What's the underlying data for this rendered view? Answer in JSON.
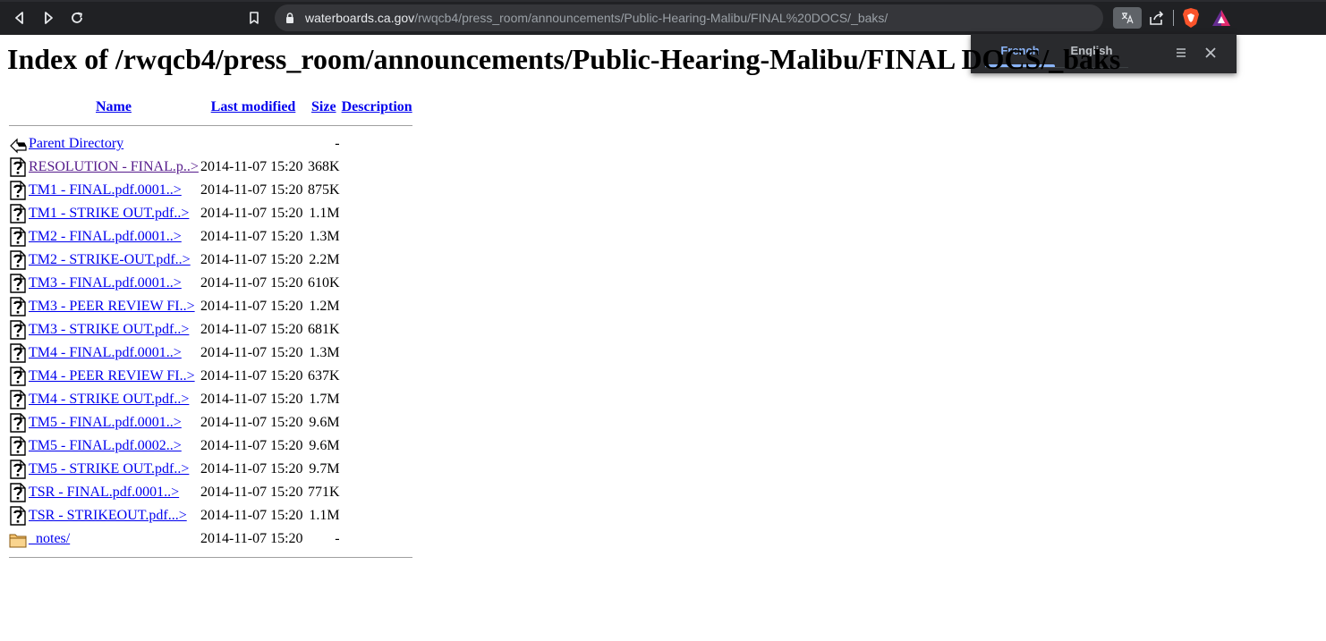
{
  "browser": {
    "url_host": "waterboards.ca.gov",
    "url_path": "/rwqcb4/press_room/announcements/Public-Hearing-Malibu/FINAL%20DOCS/_baks/",
    "translate_popup": {
      "tabs": [
        {
          "label": "French",
          "active": true
        },
        {
          "label": "English",
          "active": false
        }
      ]
    },
    "colors": {
      "toolbar": "#202124",
      "omnibox": "#35363a",
      "popup": "#292a2d",
      "accent": "#8ab4f8"
    }
  },
  "page": {
    "title": "Index of /rwqcb4/press_room/announcements/Public-Hearing-Malibu/FINAL DOCS/_baks",
    "columns": {
      "name": "Name",
      "last_modified": "Last modified",
      "size": "Size",
      "description": "Description"
    },
    "parent": {
      "name": "Parent Directory",
      "size": "-",
      "icon": "back-icon"
    },
    "files": [
      {
        "name": "RESOLUTION - FINAL.p..>",
        "modified": "2014-11-07 15:20",
        "size": "368K",
        "icon": "unknown-file-icon",
        "visited": true
      },
      {
        "name": "TM1 - FINAL.pdf.0001..>",
        "modified": "2014-11-07 15:20",
        "size": "875K",
        "icon": "unknown-file-icon"
      },
      {
        "name": "TM1 - STRIKE OUT.pdf..>",
        "modified": "2014-11-07 15:20",
        "size": "1.1M",
        "icon": "unknown-file-icon"
      },
      {
        "name": "TM2 - FINAL.pdf.0001..>",
        "modified": "2014-11-07 15:20",
        "size": "1.3M",
        "icon": "unknown-file-icon"
      },
      {
        "name": "TM2 - STRIKE-OUT.pdf..>",
        "modified": "2014-11-07 15:20",
        "size": "2.2M",
        "icon": "unknown-file-icon"
      },
      {
        "name": "TM3 - FINAL.pdf.0001..>",
        "modified": "2014-11-07 15:20",
        "size": "610K",
        "icon": "unknown-file-icon"
      },
      {
        "name": "TM3 - PEER REVIEW FI..>",
        "modified": "2014-11-07 15:20",
        "size": "1.2M",
        "icon": "unknown-file-icon"
      },
      {
        "name": "TM3 - STRIKE OUT.pdf..>",
        "modified": "2014-11-07 15:20",
        "size": "681K",
        "icon": "unknown-file-icon"
      },
      {
        "name": "TM4 - FINAL.pdf.0001..>",
        "modified": "2014-11-07 15:20",
        "size": "1.3M",
        "icon": "unknown-file-icon"
      },
      {
        "name": "TM4 - PEER REVIEW FI..>",
        "modified": "2014-11-07 15:20",
        "size": "637K",
        "icon": "unknown-file-icon"
      },
      {
        "name": "TM4 - STRIKE OUT.pdf..>",
        "modified": "2014-11-07 15:20",
        "size": "1.7M",
        "icon": "unknown-file-icon"
      },
      {
        "name": "TM5 - FINAL.pdf.0001..>",
        "modified": "2014-11-07 15:20",
        "size": "9.6M",
        "icon": "unknown-file-icon"
      },
      {
        "name": "TM5 - FINAL.pdf.0002..>",
        "modified": "2014-11-07 15:20",
        "size": "9.6M",
        "icon": "unknown-file-icon"
      },
      {
        "name": "TM5 - STRIKE OUT.pdf..>",
        "modified": "2014-11-07 15:20",
        "size": "9.7M",
        "icon": "unknown-file-icon"
      },
      {
        "name": "TSR - FINAL.pdf.0001..>",
        "modified": "2014-11-07 15:20",
        "size": "771K",
        "icon": "unknown-file-icon"
      },
      {
        "name": "TSR - STRIKEOUT.pdf...>",
        "modified": "2014-11-07 15:20",
        "size": "1.1M",
        "icon": "unknown-file-icon"
      },
      {
        "name": "_notes/",
        "modified": "2014-11-07 15:20",
        "size": "-",
        "icon": "folder-icon"
      }
    ]
  }
}
